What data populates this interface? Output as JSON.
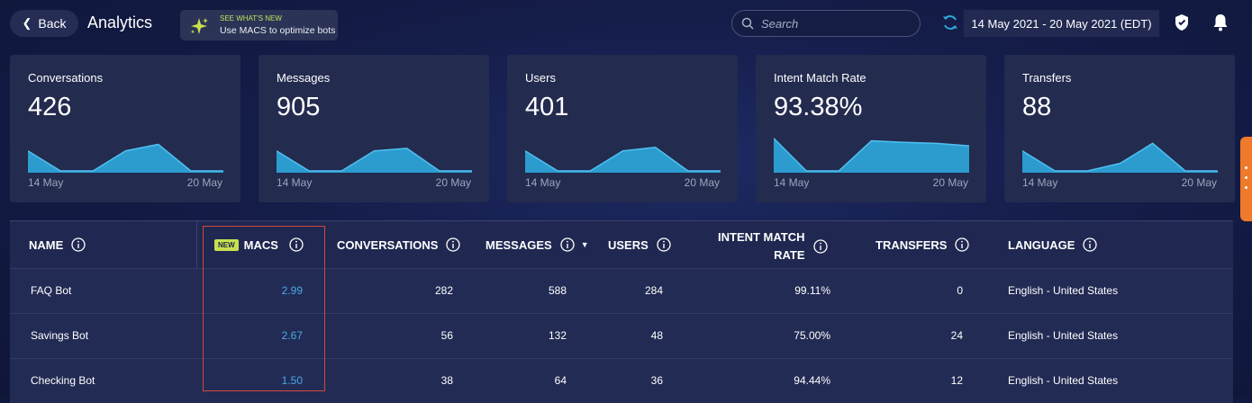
{
  "header": {
    "back_label": "Back",
    "title": "Analytics",
    "whats_new": {
      "heading": "SEE WHAT'S NEW",
      "text": "Use MACS to optimize bots"
    },
    "search_placeholder": "Search",
    "date_range": "14 May 2021 - 20 May 2021 (EDT)"
  },
  "kpis": [
    {
      "title": "Conversations",
      "value": "426",
      "start": "14 May",
      "end": "20 May",
      "trend": [
        40,
        0,
        0,
        40,
        53,
        0,
        0
      ]
    },
    {
      "title": "Messages",
      "value": "905",
      "start": "14 May",
      "end": "20 May",
      "trend": [
        40,
        0,
        0,
        40,
        45,
        0,
        0
      ]
    },
    {
      "title": "Users",
      "value": "401",
      "start": "14 May",
      "end": "20 May",
      "trend": [
        40,
        0,
        0,
        40,
        47,
        0,
        0
      ]
    },
    {
      "title": "Intent Match Rate",
      "value": "93.38%",
      "start": "14 May",
      "end": "20 May",
      "trend": [
        65,
        0,
        0,
        60,
        57,
        55,
        50
      ]
    },
    {
      "title": "Transfers",
      "value": "88",
      "start": "14 May",
      "end": "20 May",
      "trend": [
        40,
        0,
        0,
        15,
        55,
        0,
        0
      ]
    }
  ],
  "table": {
    "columns": {
      "name": "NAME",
      "new_badge": "NEW",
      "macs": "MACS",
      "conversations": "CONVERSATIONS",
      "messages": "MESSAGES",
      "users": "USERS",
      "intent_line1": "INTENT MATCH",
      "intent_line2": "RATE",
      "transfers": "TRANSFERS",
      "language": "LANGUAGE"
    },
    "rows": [
      {
        "name": "FAQ Bot",
        "macs": "2.99",
        "conversations": "282",
        "messages": "588",
        "users": "284",
        "intent": "99.11%",
        "transfers": "0",
        "language": "English - United States"
      },
      {
        "name": "Savings Bot",
        "macs": "2.67",
        "conversations": "56",
        "messages": "132",
        "users": "48",
        "intent": "75.00%",
        "transfers": "24",
        "language": "English - United States"
      },
      {
        "name": "Checking Bot",
        "macs": "1.50",
        "conversations": "38",
        "messages": "64",
        "users": "36",
        "intent": "94.44%",
        "transfers": "12",
        "language": "English - United States"
      }
    ]
  },
  "colors": {
    "accent": "#2ea8dd",
    "highlight_box": "#d9433f",
    "new_badge": "#c8e04f",
    "side_tab": "#f07a2b"
  }
}
